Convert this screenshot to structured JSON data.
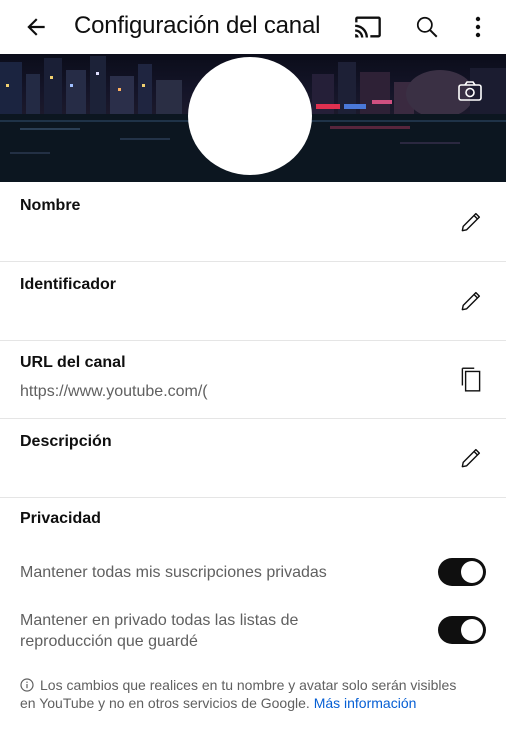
{
  "appbar": {
    "title": "Configuración del canal",
    "icons": [
      "back-arrow-icon",
      "cast-icon",
      "search-icon",
      "more-vert-icon"
    ]
  },
  "fields": [
    {
      "label": "Nombre",
      "value": "",
      "action": "pencil-icon"
    },
    {
      "label": "Identificador",
      "value": "",
      "action": "pencil-icon"
    },
    {
      "label": "URL del canal",
      "value": "https://www.youtube.com/(",
      "action": "copy-icon"
    },
    {
      "label": "Descripción",
      "value": "",
      "action": "pencil-icon"
    }
  ],
  "privacy": {
    "title": "Privacidad",
    "subscriptions_label": "Mantener todas mis suscripciones privadas",
    "subscriptions_on": true,
    "playlists_label_line1": "Mantener en privado todas las listas de",
    "playlists_label_line2": "reproducción que guardé",
    "playlists_on": true
  },
  "info": {
    "text_line1": "Los cambios que realices en tu nombre y avatar solo serán visibles",
    "text_line2": "en YouTube y no en otros servicios de Google.",
    "link": "Más información"
  },
  "colors": {
    "accent_link": "#065fd4",
    "toggle_on": "#0f0f0f"
  }
}
